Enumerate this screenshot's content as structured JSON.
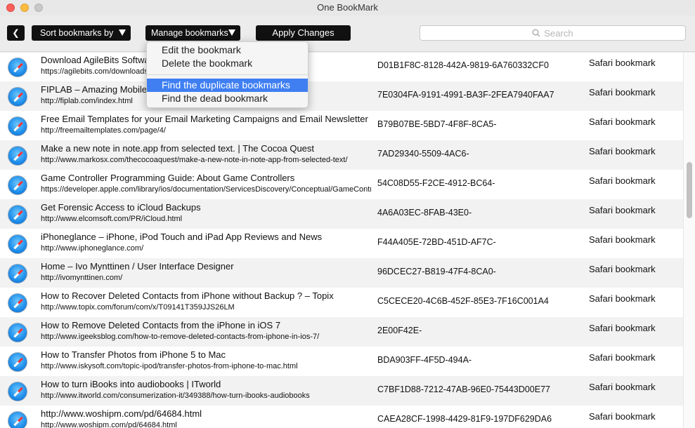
{
  "window": {
    "title": "One BookMark"
  },
  "toolbar": {
    "back_label": "❮",
    "sort_label": "Sort bookmarks by",
    "manage_label": "Manage bookmarks",
    "apply_label": "Apply Changes",
    "search_placeholder": "Search"
  },
  "menu": {
    "items": [
      {
        "label": "Edit the bookmark"
      },
      {
        "label": "Delete the bookmark"
      },
      {
        "label": "Find the duplicate bookmarks",
        "selected": true
      },
      {
        "label": "Find the dead bookmark"
      }
    ]
  },
  "bookmarks": [
    {
      "title": "Download AgileBits Software",
      "url": "https://agilebits.com/downloads",
      "id": "D01B1F8C-8128-442A-9819-6A760332CF0",
      "type": "Safari bookmark"
    },
    {
      "title": "FIPLAB – Amazing Mobile Apps",
      "url": "http://fiplab.com/index.html",
      "id": "7E0304FA-9191-4991-BA3F-2FEA7940FAA7",
      "type": "Safari bookmark"
    },
    {
      "title": "Free Email Templates for your Email Marketing Campaigns and Email Newsletters",
      "url": "http://freemailtemplates.com/page/4/",
      "id": "B79B07BE-5BD7-4F8F-8CA5-",
      "type": "Safari bookmark"
    },
    {
      "title": "Make a new note in note.app from selected text. | The Cocoa Quest",
      "url": "http://www.markosx.com/thecocoaquest/make-a-new-note-in-note-app-from-selected-text/",
      "id": "7AD29340-5509-4AC6-",
      "type": "Safari bookmark"
    },
    {
      "title": "Game Controller Programming Guide: About Game Controllers",
      "url": "https://developer.apple.com/library/ios/documentation/ServicesDiscovery/Conceptual/GameControllerPG/",
      "id": "54C08D55-F2CE-4912-BC64-",
      "type": "Safari bookmark"
    },
    {
      "title": "Get Forensic Access to iCloud Backups",
      "url": "http://www.elcomsoft.com/PR/iCloud.html",
      "id": "4A6A03EC-8FAB-43E0-",
      "type": "Safari bookmark"
    },
    {
      "title": "iPhoneglance – iPhone, iPod Touch and iPad App Reviews and News",
      "url": "http://www.iphoneglance.com/",
      "id": "F44A405E-72BD-451D-AF7C-",
      "type": "Safari bookmark"
    },
    {
      "title": "Home – Ivo Mynttinen / User Interface Designer",
      "url": "http://ivomynttinen.com/",
      "id": "96DCEC27-B819-47F4-8CA0-",
      "type": "Safari bookmark"
    },
    {
      "title": "How to Recover Deleted Contacts from iPhone without Backup ? – Topix",
      "url": "http://www.topix.com/forum/com/x/T09141T359JJS26LM",
      "id": "C5CECE20-4C6B-452F-85E3-7F16C001A4",
      "type": "Safari bookmark"
    },
    {
      "title": "How to Remove Deleted Contacts from the iPhone in iOS 7",
      "url": "http://www.igeeksblog.com/how-to-remove-deleted-contacts-from-iphone-in-ios-7/",
      "id": "2E00F42E-",
      "type": "Safari bookmark"
    },
    {
      "title": "How to Transfer Photos from iPhone 5 to Mac",
      "url": "http://www.iskysoft.com/topic-ipod/transfer-photos-from-iphone-to-mac.html",
      "id": "BDA903FF-4F5D-494A-",
      "type": "Safari bookmark"
    },
    {
      "title": "How to turn iBooks into audiobooks | ITworld",
      "url": "http://www.itworld.com/consumerization-it/349388/how-turn-ibooks-audiobooks",
      "id": "C7BF1D88-7212-47AB-96E0-75443D00E77",
      "type": "Safari bookmark"
    },
    {
      "title": "http://www.woshipm.com/pd/64684.html",
      "url": "http://www.woshipm.com/pd/64684.html",
      "id": "CAEA28CF-1998-4429-81F9-197DF629DA6",
      "type": "Safari bookmark"
    }
  ]
}
